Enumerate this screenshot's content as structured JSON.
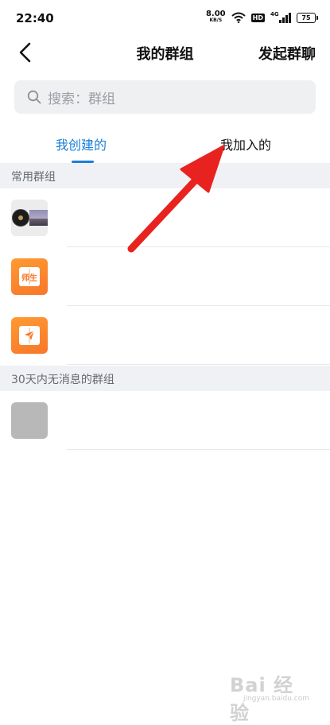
{
  "status_bar": {
    "time": "22:40",
    "net_speed": "8.00",
    "net_unit": "KB/S",
    "hd_badge": "HD",
    "signal_label": "4G",
    "battery": "75",
    "icons": [
      "wifi-icon",
      "hd-badge",
      "signal-icon",
      "battery-icon"
    ]
  },
  "nav": {
    "back_icon": "chevron-left-icon",
    "title": "我的群组",
    "action_label": "发起群聊"
  },
  "search": {
    "placeholder": "搜索：群组",
    "icon": "search-icon"
  },
  "tabs": [
    {
      "label": "我创建的",
      "active": true
    },
    {
      "label": "我加入的",
      "active": false
    }
  ],
  "sections": [
    {
      "title": "常用群组"
    },
    {
      "title": "30天内无消息的群组"
    }
  ],
  "groups": {
    "common": [
      {
        "avatar": "photo-collage"
      },
      {
        "avatar": "book-icon",
        "avatar_label": "师生"
      },
      {
        "avatar": "book-icon"
      }
    ],
    "inactive": [
      {
        "avatar": "gray-placeholder"
      }
    ]
  },
  "annotation": {
    "type": "red-arrow",
    "points_to": "tab-joined"
  },
  "colors": {
    "accent": "#1a7fd8",
    "search_bg": "#eff0f2",
    "section_bg": "#f0f1f4",
    "avatar_orange": "#f7772a",
    "arrow": "#e8231f"
  },
  "watermark": {
    "text": "Bai 经验",
    "url": "jingyan.baidu.com"
  }
}
